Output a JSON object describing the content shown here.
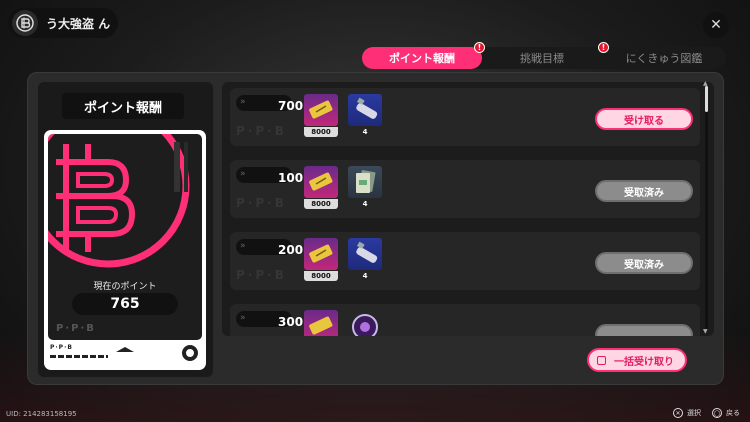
{
  "header": {
    "title": "う大強盗  ん",
    "close_label": "✕"
  },
  "tabs": [
    {
      "label": "ポイント報酬",
      "active": true,
      "badge": "!"
    },
    {
      "label": "挑戦目標",
      "active": false,
      "badge": ""
    },
    {
      "label": "にくきゅう図鑑",
      "active": false,
      "badge": "!"
    }
  ],
  "left": {
    "title": "ポイント報酬",
    "points_label": "現在のポイント",
    "points_value": "765",
    "card_watermark": "P·P·B",
    "card_footer": "P·P·B"
  },
  "rewards": [
    {
      "required": "700",
      "items": [
        {
          "icon": "ticket-icon",
          "qty": "8000",
          "color": "purple"
        },
        {
          "icon": "tube-icon",
          "qty": "4",
          "color": "blue"
        }
      ],
      "button": "受け取る",
      "state": "claimable"
    },
    {
      "required": "100",
      "items": [
        {
          "icon": "ticket-icon",
          "qty": "8000",
          "color": "purple"
        },
        {
          "icon": "card-pack-icon",
          "qty": "4",
          "color": "blue"
        }
      ],
      "button": "受取済み",
      "state": "claimed"
    },
    {
      "required": "200",
      "items": [
        {
          "icon": "ticket-icon",
          "qty": "8000",
          "color": "purple"
        },
        {
          "icon": "tube-icon",
          "qty": "4",
          "color": "blue"
        }
      ],
      "button": "受取済み",
      "state": "claimed"
    },
    {
      "required": "300",
      "items": [
        {
          "icon": "ticket-icon",
          "qty": "",
          "color": "purple"
        },
        {
          "icon": "orb-icon",
          "qty": "",
          "color": "blue"
        }
      ],
      "button": "",
      "state": "claimed"
    }
  ],
  "claim_all_label": "一括受け取り",
  "footer": {
    "uid": "UID: 214283158195",
    "select_key": "✕",
    "select_label": "選択",
    "back_key": "◯",
    "back_label": "戻る"
  },
  "colors": {
    "accent": "#ff2f77",
    "claimed": "#8c8c8c",
    "panel": "#2b2b2b"
  }
}
